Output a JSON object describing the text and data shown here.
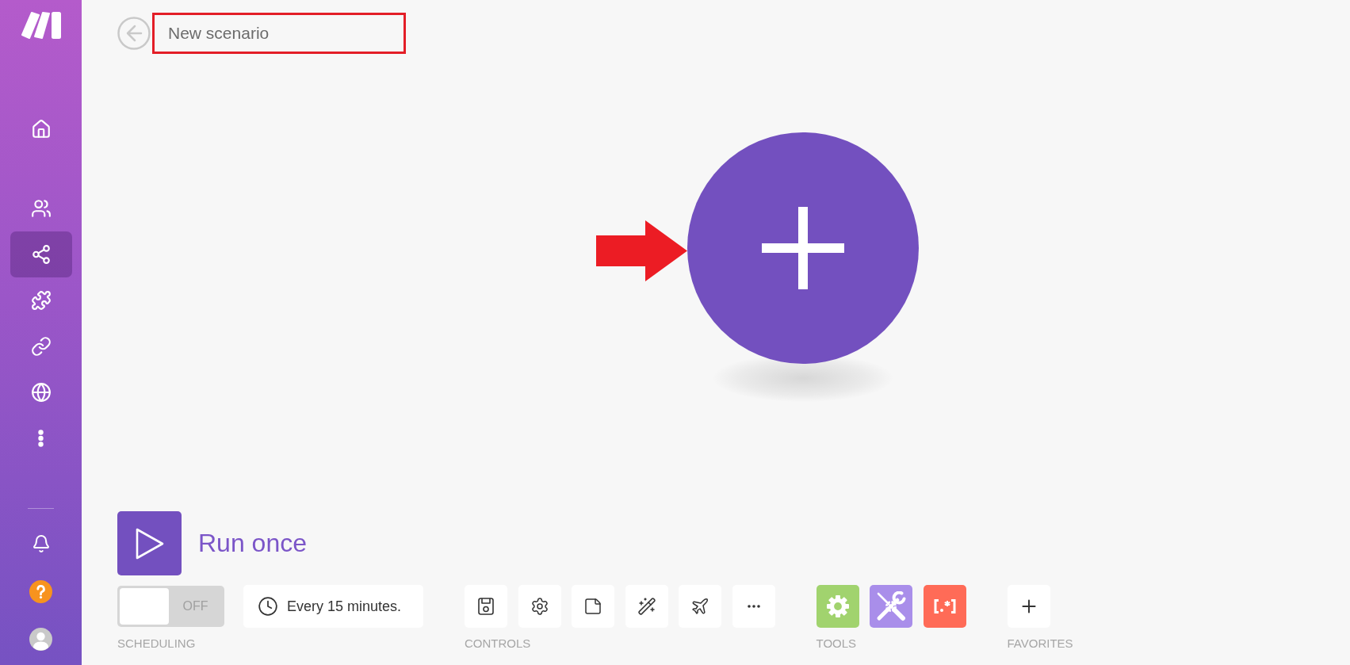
{
  "sidebar": {
    "items": [
      {
        "selected": false
      },
      {
        "selected": false
      },
      {
        "selected": true
      },
      {
        "selected": false
      },
      {
        "selected": false
      },
      {
        "selected": false
      },
      {
        "selected": false
      }
    ]
  },
  "scenario_name": {
    "value": "New scenario",
    "highlighted": true
  },
  "canvas": {
    "pointer_arrow": true
  },
  "run": {
    "label": "Run once"
  },
  "scheduling": {
    "on": false,
    "switch_label": "OFF",
    "interval": "Every 15 minutes.",
    "label": "SCHEDULING"
  },
  "controls": {
    "label": "CONTROLS"
  },
  "tools": {
    "label": "TOOLS",
    "items": [
      {
        "color": "#a1d36e"
      },
      {
        "color": "#a98eea"
      },
      {
        "color": "#ff6b57"
      }
    ]
  },
  "favorites": {
    "label": "FAVORITES"
  }
}
